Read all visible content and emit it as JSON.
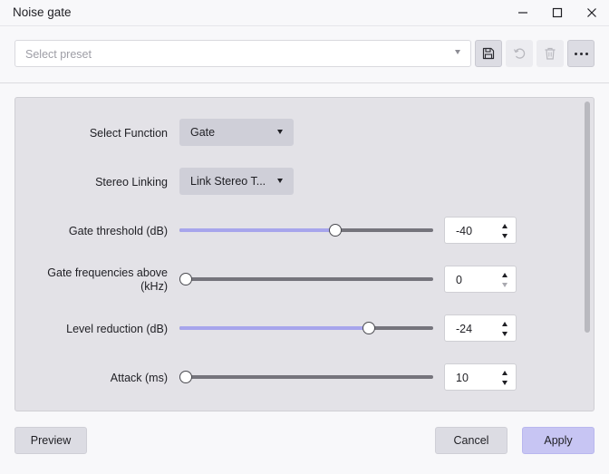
{
  "window": {
    "title": "Noise gate"
  },
  "toolbar": {
    "preset_placeholder": "Select preset"
  },
  "controls": {
    "function_label": "Select Function",
    "function_value": "Gate",
    "stereo_label": "Stereo Linking",
    "stereo_value": "Link Stereo T...",
    "threshold_label": "Gate threshold (dB)",
    "threshold_value": "-40",
    "frequencies_label_line1": "Gate frequencies above",
    "frequencies_label_line2": "(kHz)",
    "frequencies_value": "0",
    "reduction_label": "Level reduction (dB)",
    "reduction_value": "-24",
    "attack_label": "Attack (ms)",
    "attack_value": "10"
  },
  "sliders": {
    "threshold_fraction": 0.615,
    "frequencies_fraction": 0.0,
    "reduction_fraction": 0.745,
    "attack_fraction": 0.01
  },
  "buttons": {
    "preview": "Preview",
    "cancel": "Cancel",
    "apply": "Apply"
  },
  "colors": {
    "accent": "#a7a5ec",
    "apply_bg": "#c7c5f3",
    "panel_bg": "#e3e2e7"
  },
  "icons": {
    "save": "save-icon",
    "undo": "undo-icon",
    "delete": "trash-icon",
    "more": "more-icon",
    "minimize": "minimize-icon",
    "maximize": "maximize-icon",
    "close": "close-icon"
  }
}
